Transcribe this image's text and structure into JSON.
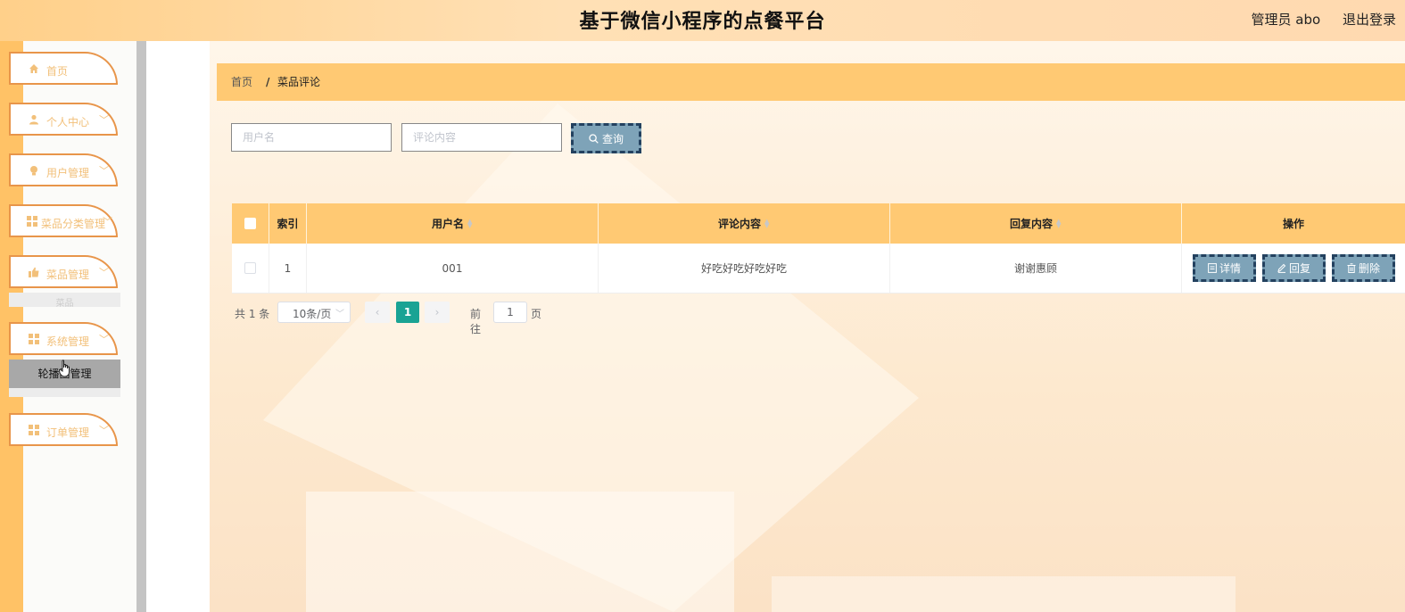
{
  "header": {
    "title": "基于微信小程序的点餐平台",
    "user_label": "管理员 abo",
    "logout_label": "退出登录"
  },
  "sidebar": {
    "items": [
      {
        "label": "首页",
        "icon": "home-icon"
      },
      {
        "label": "个人中心",
        "icon": "person-icon"
      },
      {
        "label": "用户管理",
        "icon": "bulb-icon"
      },
      {
        "label": "菜品分类管理",
        "icon": "grid-icon"
      },
      {
        "label": "菜品管理",
        "icon": "thumb-icon"
      },
      {
        "label": "系统管理",
        "icon": "grid-icon"
      },
      {
        "label": "订单管理",
        "icon": "grid-icon"
      }
    ],
    "ghost_subitem": "菜品",
    "active_subitem": "轮播图管理"
  },
  "breadcrumb": {
    "home": "首页",
    "separator": "/",
    "current": "菜品评论"
  },
  "search": {
    "username_placeholder": "用户名",
    "content_placeholder": "评论内容",
    "button_label": "查询"
  },
  "table": {
    "headers": [
      "索引",
      "用户名",
      "评论内容",
      "回复内容",
      "操作"
    ],
    "rows": [
      {
        "index": "1",
        "username": "001",
        "content": "好吃好吃好吃好吃",
        "reply": "谢谢惠顾"
      }
    ],
    "actions": {
      "detail": "详情",
      "reply": "回复",
      "delete": "删除"
    }
  },
  "pagination": {
    "total": "共 1 条",
    "page_size": "10条/页",
    "current_page": "1",
    "goto_label": "前往",
    "goto_value": "1",
    "page_unit": "页"
  },
  "colors": {
    "accent": "#ffc973",
    "button": "#7ea3b8",
    "button_border": "#23415f",
    "pager_active": "#1aa394"
  }
}
